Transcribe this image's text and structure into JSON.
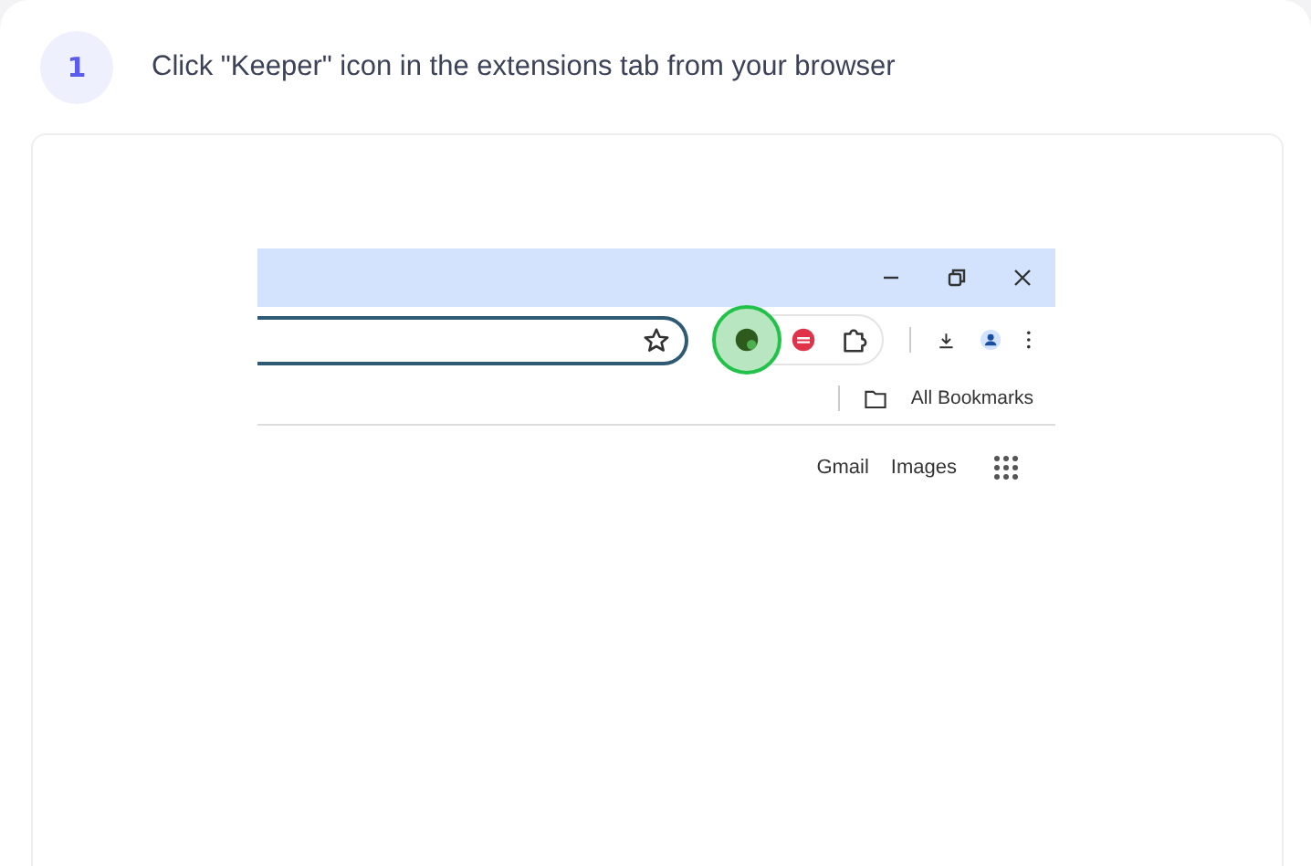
{
  "step": {
    "number": "1",
    "instruction": "Click \"Keeper\" icon in the extensions tab from your browser"
  },
  "browser": {
    "bookmarks_label": "All Bookmarks",
    "links": [
      "Gmail",
      "Images"
    ],
    "extension_highlighted": true
  }
}
